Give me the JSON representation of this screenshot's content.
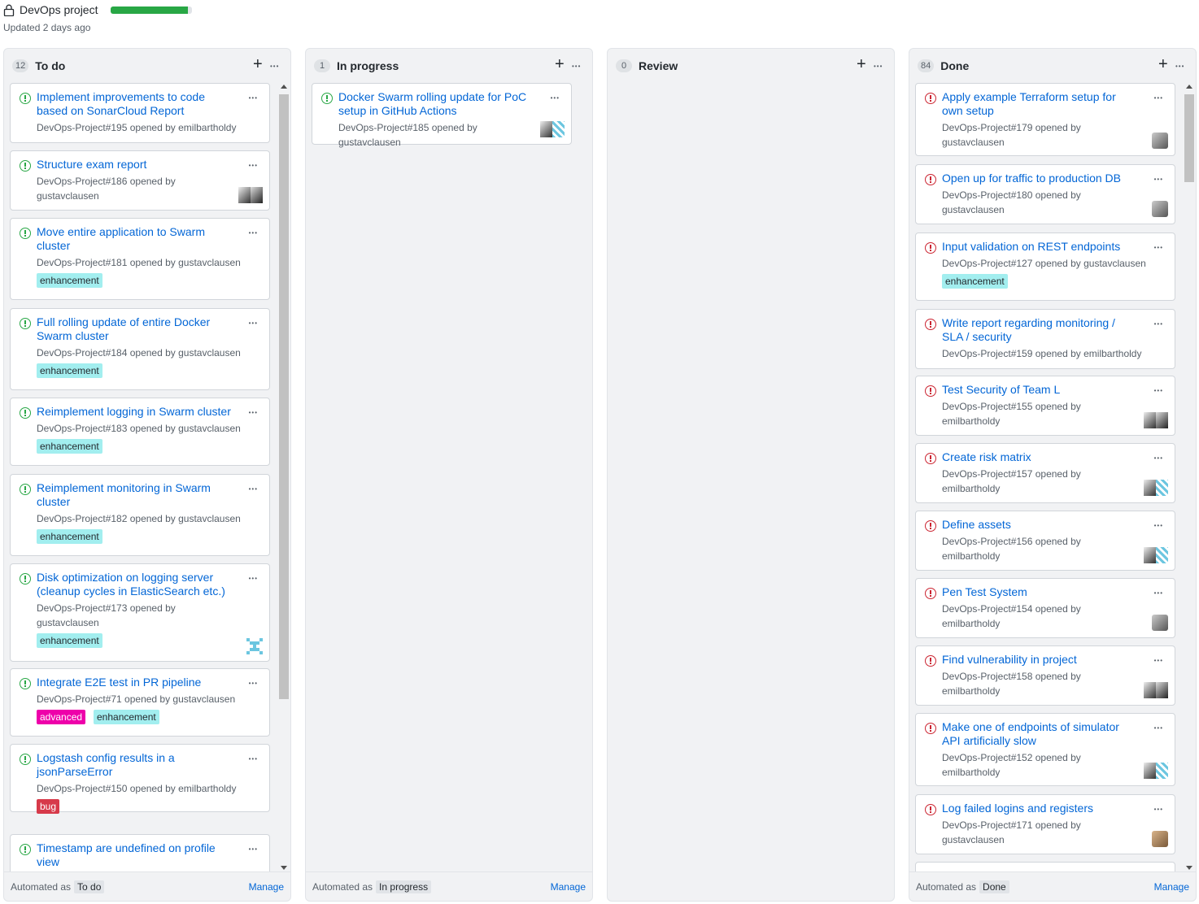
{
  "header": {
    "title": "DevOps project",
    "updated": "Updated 2 days ago",
    "progress_percent": 95,
    "progress_color": "#28a745"
  },
  "columns": [
    {
      "name": "To do",
      "count": "12",
      "footer": {
        "prefix": "Automated as",
        "value": "To do",
        "manage": "Manage"
      },
      "cards": [
        {
          "title_lines": [
            "Implement improvements to code",
            "based on SonarCloud Report"
          ],
          "meta_lines": [
            "DevOps-Project#195 opened by emilbartholdy"
          ],
          "labels": [],
          "avatar": "none",
          "state": "open"
        },
        {
          "title_lines": [
            "Structure exam report"
          ],
          "meta_lines": [
            "DevOps-Project#186 opened by",
            "gustavclausen"
          ],
          "labels": [],
          "avatar": "double-photo",
          "state": "open"
        },
        {
          "title_lines": [
            "Move entire application to Swarm",
            "cluster"
          ],
          "meta_lines": [
            "DevOps-Project#181 opened by gustavclausen"
          ],
          "labels": [
            "enhancement"
          ],
          "avatar": "none",
          "state": "open"
        },
        {
          "title_lines": [
            "Full rolling update of entire Docker",
            "Swarm cluster"
          ],
          "meta_lines": [
            "DevOps-Project#184 opened by gustavclausen"
          ],
          "labels": [
            "enhancement"
          ],
          "avatar": "none",
          "state": "open"
        },
        {
          "title_lines": [
            "Reimplement logging in Swarm cluster"
          ],
          "meta_lines": [
            "DevOps-Project#183 opened by gustavclausen"
          ],
          "labels": [
            "enhancement"
          ],
          "avatar": "none",
          "state": "open"
        },
        {
          "title_lines": [
            "Reimplement monitoring in Swarm",
            "cluster"
          ],
          "meta_lines": [
            "DevOps-Project#182 opened by gustavclausen"
          ],
          "labels": [
            "enhancement"
          ],
          "avatar": "none",
          "state": "open"
        },
        {
          "title_lines": [
            "Disk optimization on logging server",
            "(cleanup cycles in ElasticSearch etc.)"
          ],
          "meta_lines": [
            "DevOps-Project#173 opened by",
            "gustavclausen"
          ],
          "labels": [
            "enhancement"
          ],
          "avatar": "identicon",
          "state": "open"
        },
        {
          "title_lines": [
            "Integrate E2E test in PR pipeline"
          ],
          "meta_lines": [
            "DevOps-Project#71 opened by gustavclausen"
          ],
          "labels": [
            "advanced",
            "enhancement"
          ],
          "avatar": "none",
          "state": "open"
        },
        {
          "title_lines": [
            "Logstash config results in a",
            "jsonParseError"
          ],
          "meta_lines": [
            "DevOps-Project#150 opened by emilbartholdy"
          ],
          "labels": [
            "bug"
          ],
          "avatar": "none",
          "state": "open"
        },
        {
          "title_lines": [
            "Timestamp are undefined on profile",
            "view"
          ],
          "meta_lines": [],
          "labels": [],
          "avatar": "none",
          "state": "open"
        }
      ]
    },
    {
      "name": "In progress",
      "count": "1",
      "footer": {
        "prefix": "Automated as",
        "value": "In progress",
        "manage": "Manage"
      },
      "cards": [
        {
          "title_lines": [
            "Docker Swarm rolling update for PoC",
            "setup in GitHub Actions"
          ],
          "meta_lines": [
            "DevOps-Project#185 opened by",
            "gustavclausen"
          ],
          "labels": [],
          "avatar": "photo-identicon",
          "state": "open"
        }
      ]
    },
    {
      "name": "Review",
      "count": "0",
      "footer": null,
      "cards": []
    },
    {
      "name": "Done",
      "count": "84",
      "footer": {
        "prefix": "Automated as",
        "value": "Done",
        "manage": "Manage"
      },
      "cards": [
        {
          "title_lines": [
            "Apply example Terraform setup for",
            "own setup"
          ],
          "meta_lines": [
            "DevOps-Project#179 opened by",
            "gustavclausen"
          ],
          "labels": [],
          "avatar": "photo",
          "state": "closed"
        },
        {
          "title_lines": [
            "Open up for traffic to production DB"
          ],
          "meta_lines": [
            "DevOps-Project#180 opened by",
            "gustavclausen"
          ],
          "labels": [],
          "avatar": "photo",
          "state": "closed"
        },
        {
          "title_lines": [
            "Input validation on REST endpoints"
          ],
          "meta_lines": [
            "DevOps-Project#127 opened by gustavclausen"
          ],
          "labels": [
            "enhancement"
          ],
          "avatar": "none",
          "state": "closed"
        },
        {
          "title_lines": [
            "Write report regarding monitoring /",
            "SLA / security"
          ],
          "meta_lines": [
            "DevOps-Project#159 opened by emilbartholdy"
          ],
          "labels": [],
          "avatar": "none",
          "state": "closed"
        },
        {
          "title_lines": [
            "Test Security of Team L"
          ],
          "meta_lines": [
            "DevOps-Project#155 opened by",
            "emilbartholdy"
          ],
          "labels": [],
          "avatar": "double-photo",
          "state": "closed"
        },
        {
          "title_lines": [
            "Create risk matrix"
          ],
          "meta_lines": [
            "DevOps-Project#157 opened by",
            "emilbartholdy"
          ],
          "labels": [],
          "avatar": "photo-identicon",
          "state": "closed"
        },
        {
          "title_lines": [
            "Define assets"
          ],
          "meta_lines": [
            "DevOps-Project#156 opened by",
            "emilbartholdy"
          ],
          "labels": [],
          "avatar": "photo-identicon",
          "state": "closed"
        },
        {
          "title_lines": [
            "Pen Test System"
          ],
          "meta_lines": [
            "DevOps-Project#154 opened by",
            "emilbartholdy"
          ],
          "labels": [],
          "avatar": "photo",
          "state": "closed"
        },
        {
          "title_lines": [
            "Find vulnerability in project"
          ],
          "meta_lines": [
            "DevOps-Project#158 opened by",
            "emilbartholdy"
          ],
          "labels": [],
          "avatar": "double-photo",
          "state": "closed"
        },
        {
          "title_lines": [
            "Make one of endpoints of simulator",
            "API artificially slow"
          ],
          "meta_lines": [
            "DevOps-Project#152 opened by",
            "emilbartholdy"
          ],
          "labels": [],
          "avatar": "photo-identicon",
          "state": "closed"
        },
        {
          "title_lines": [
            "Log failed logins and registers"
          ],
          "meta_lines": [
            "DevOps-Project#171 opened by",
            "gustavclausen"
          ],
          "labels": [],
          "avatar": "photo-warm",
          "state": "closed"
        },
        {
          "title_lines": [],
          "meta_lines": [],
          "labels": [],
          "avatar": "none",
          "state": "closed"
        }
      ]
    }
  ],
  "label_colors": {
    "enhancement": "#a2eeef",
    "advanced": "#ee00aa",
    "bug": "#d73a4a"
  },
  "icons": {
    "lock": "lock-icon",
    "add": "plus-icon",
    "menu": "kebab-icon",
    "open": "issue-open-icon",
    "closed": "issue-closed-icon"
  }
}
